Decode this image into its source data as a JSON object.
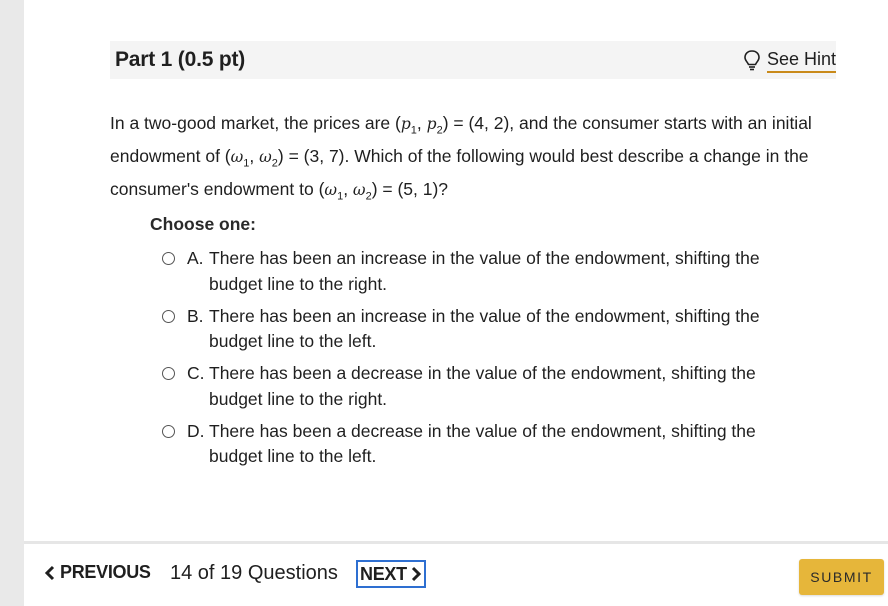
{
  "part": {
    "title": "Part 1 (0.5 pt)",
    "hint_label": "See Hint"
  },
  "question": {
    "t1": "In a two-good market, the prices are (",
    "p1": "p",
    "p1_sub": "1",
    "sep1": ", ",
    "p2": "p",
    "p2_sub": "2",
    "t2": ") = (4, 2), and the consumer starts with an initial endowment of (",
    "w1": "ω",
    "w1_sub": "1",
    "sep2": ", ",
    "w2": "ω",
    "w2_sub": "2",
    "t3": ") = (3, 7). Which of the following would best describe a change in the consumer's endowment to (",
    "w3": "ω",
    "w3_sub": "1",
    "sep3": ", ",
    "w4": "ω",
    "w4_sub": "2",
    "t4": ") = (5, 1)?"
  },
  "choose_label": "Choose one:",
  "options": [
    {
      "letter": "A.",
      "text": "There has been an increase in the value of the endowment, shifting the budget line to the right."
    },
    {
      "letter": "B.",
      "text": "There has been an increase in the value of the endowment, shifting the budget line to the left."
    },
    {
      "letter": "C.",
      "text": "There has been a decrease in the value of the endowment, shifting the budget line to the right."
    },
    {
      "letter": "D.",
      "text": "There has been a decrease in the value of the endowment, shifting the budget line to the left."
    }
  ],
  "footer": {
    "previous_label": "PREVIOUS",
    "counter": "14 of 19 Questions",
    "next_label": "NEXT",
    "submit_label": "SUBMIT"
  },
  "icons": {
    "hint": "lightbulb-icon",
    "prev": "chevron-left-icon",
    "next": "chevron-right-icon"
  },
  "colors": {
    "hint_underline": "#c98a1a",
    "next_border": "#2e6fd1",
    "submit_bg": "#e6b63a"
  }
}
